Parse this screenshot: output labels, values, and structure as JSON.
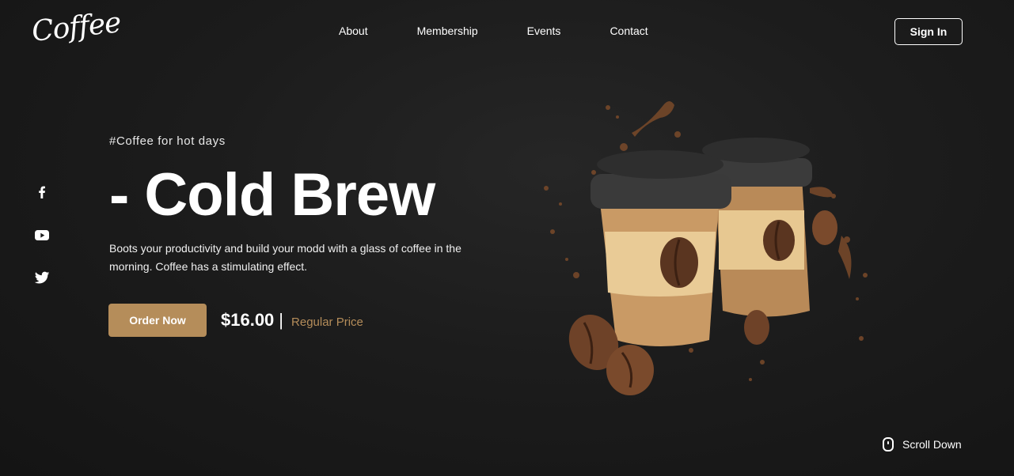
{
  "brand": {
    "logo_text": "Coffee"
  },
  "nav": {
    "items": [
      {
        "label": "About"
      },
      {
        "label": "Membership"
      },
      {
        "label": "Events"
      },
      {
        "label": "Contact"
      }
    ]
  },
  "header": {
    "signin_label": "Sign In"
  },
  "social": {
    "icons": [
      "facebook-icon",
      "youtube-icon",
      "twitter-icon"
    ]
  },
  "hero": {
    "tagline": "#Coffee for hot days",
    "headline": "- Cold Brew",
    "description": "Boots your productivity and build your modd with a glass of coffee in the morning. Coffee has a stimulating effect.",
    "cta_label": "Order Now",
    "price": "$16.00",
    "separator": "|",
    "price_note": "Regular Price",
    "image": "coffee-cups-illustration"
  },
  "footer": {
    "scroll_label": "Scroll Down",
    "scroll_icon": "mouse-icon"
  },
  "colors": {
    "accent": "#b58d5a",
    "background": "#1c1c1c",
    "text": "#ffffff"
  }
}
